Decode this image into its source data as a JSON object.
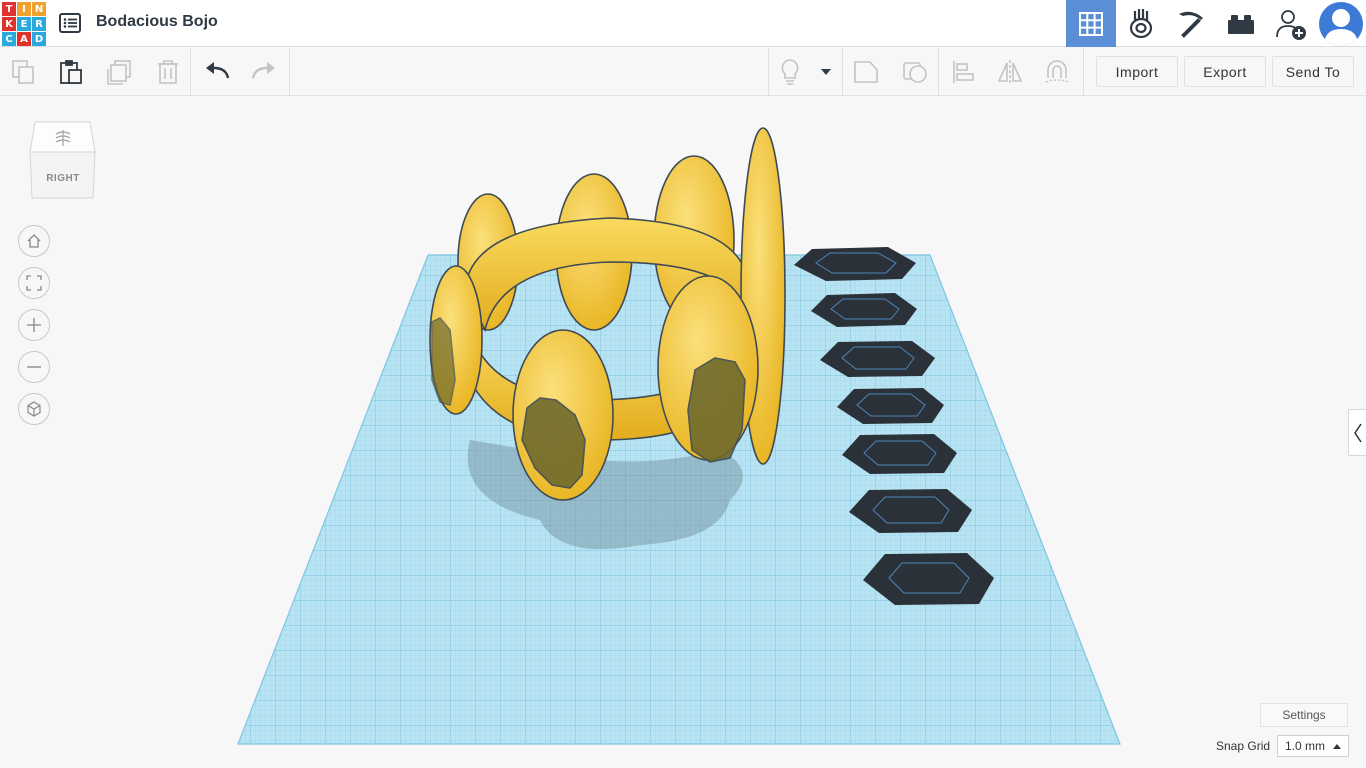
{
  "app": {
    "logo_letters": [
      "T",
      "I",
      "N",
      "K",
      "E",
      "R",
      "C",
      "A",
      "D"
    ],
    "logo_colors": [
      "#e1312d",
      "#f0a12e",
      "#f0a12e",
      "#e1312d",
      "#2aa9df",
      "#2aa9df",
      "#2aa9df",
      "#e1312d",
      "#2aa9df"
    ],
    "design_title": "Bodacious Bojo"
  },
  "topnav": {
    "items": [
      {
        "name": "3d-design-grid-icon",
        "active": true
      },
      {
        "name": "circuits-icon",
        "active": false
      },
      {
        "name": "codeblocks-pickaxe-icon",
        "active": false
      },
      {
        "name": "bricks-icon",
        "active": false
      },
      {
        "name": "add-user-icon",
        "active": false
      }
    ],
    "accent": "#5a8fd8"
  },
  "toolbar": {
    "import_label": "Import",
    "export_label": "Export",
    "send_to_label": "Send To"
  },
  "viewcube": {
    "face_label": "RIGHT"
  },
  "view_controls": [
    "home-view-icon",
    "fit-all-icon",
    "zoom-in-icon",
    "zoom-out-icon",
    "ortho-perspective-icon"
  ],
  "bottom": {
    "settings_label": "Settings",
    "snap_grid_label": "Snap Grid",
    "snap_grid_value": "1.0 mm"
  },
  "scene": {
    "object_color": "#f2c63a",
    "gem_color": "#2a3138",
    "grid_color": "#a9dcef",
    "gem_count": 7
  }
}
